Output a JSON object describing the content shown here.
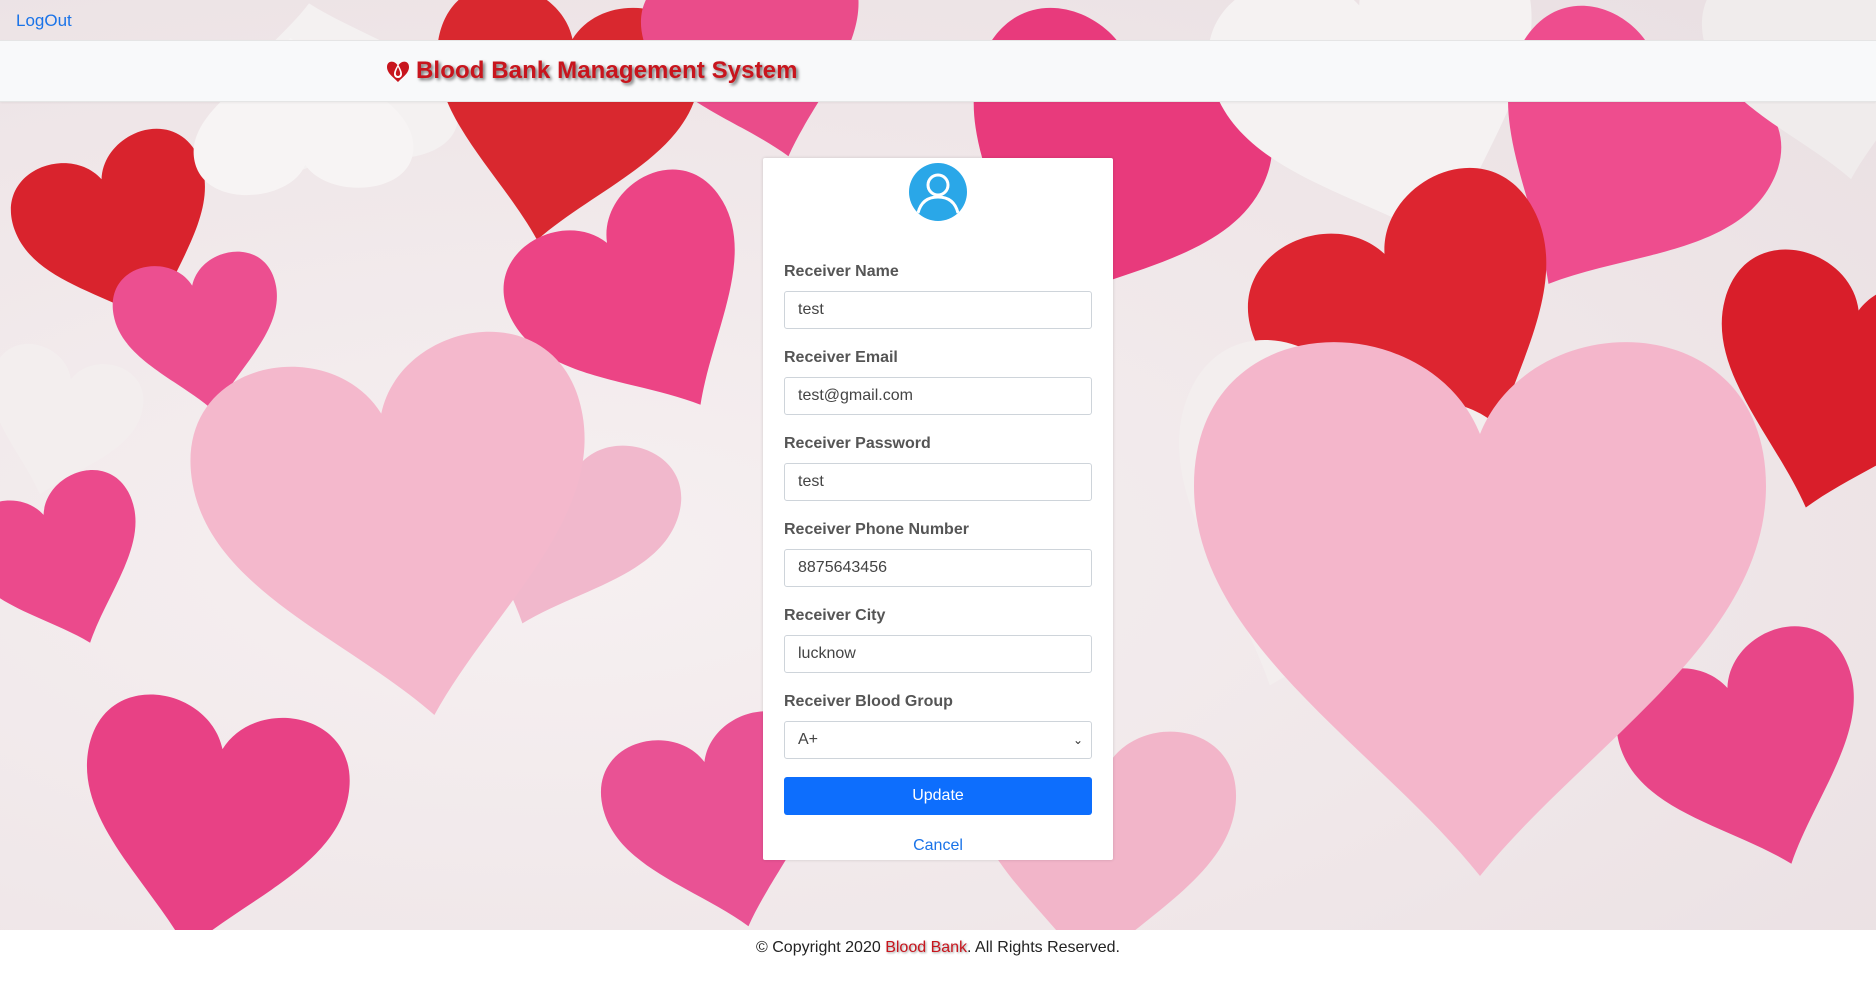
{
  "header": {
    "logout_label": "LogOut",
    "brand_title": "Blood Bank Management System",
    "brand_icon": "blood-drop-heart-icon"
  },
  "form": {
    "avatar_icon": "user-avatar-icon",
    "fields": [
      {
        "label": "Receiver Name",
        "value": "test"
      },
      {
        "label": "Receiver Email",
        "value": "test@gmail.com"
      },
      {
        "label": "Receiver Password",
        "value": "test"
      },
      {
        "label": "Receiver Phone Number",
        "value": "8875643456"
      },
      {
        "label": "Receiver City",
        "value": "lucknow"
      }
    ],
    "blood_group": {
      "label": "Receiver Blood Group",
      "value": "A+"
    },
    "update_label": "Update",
    "cancel_label": "Cancel"
  },
  "footer": {
    "prefix": "© Copyright 2020 ",
    "brand": "Blood Bank",
    "suffix": ". All Rights Reserved."
  },
  "colors": {
    "brand_red": "#c8151d",
    "primary_blue": "#0d6efd",
    "link_blue": "#1a73e8",
    "avatar_blue": "#2aa7e8"
  }
}
